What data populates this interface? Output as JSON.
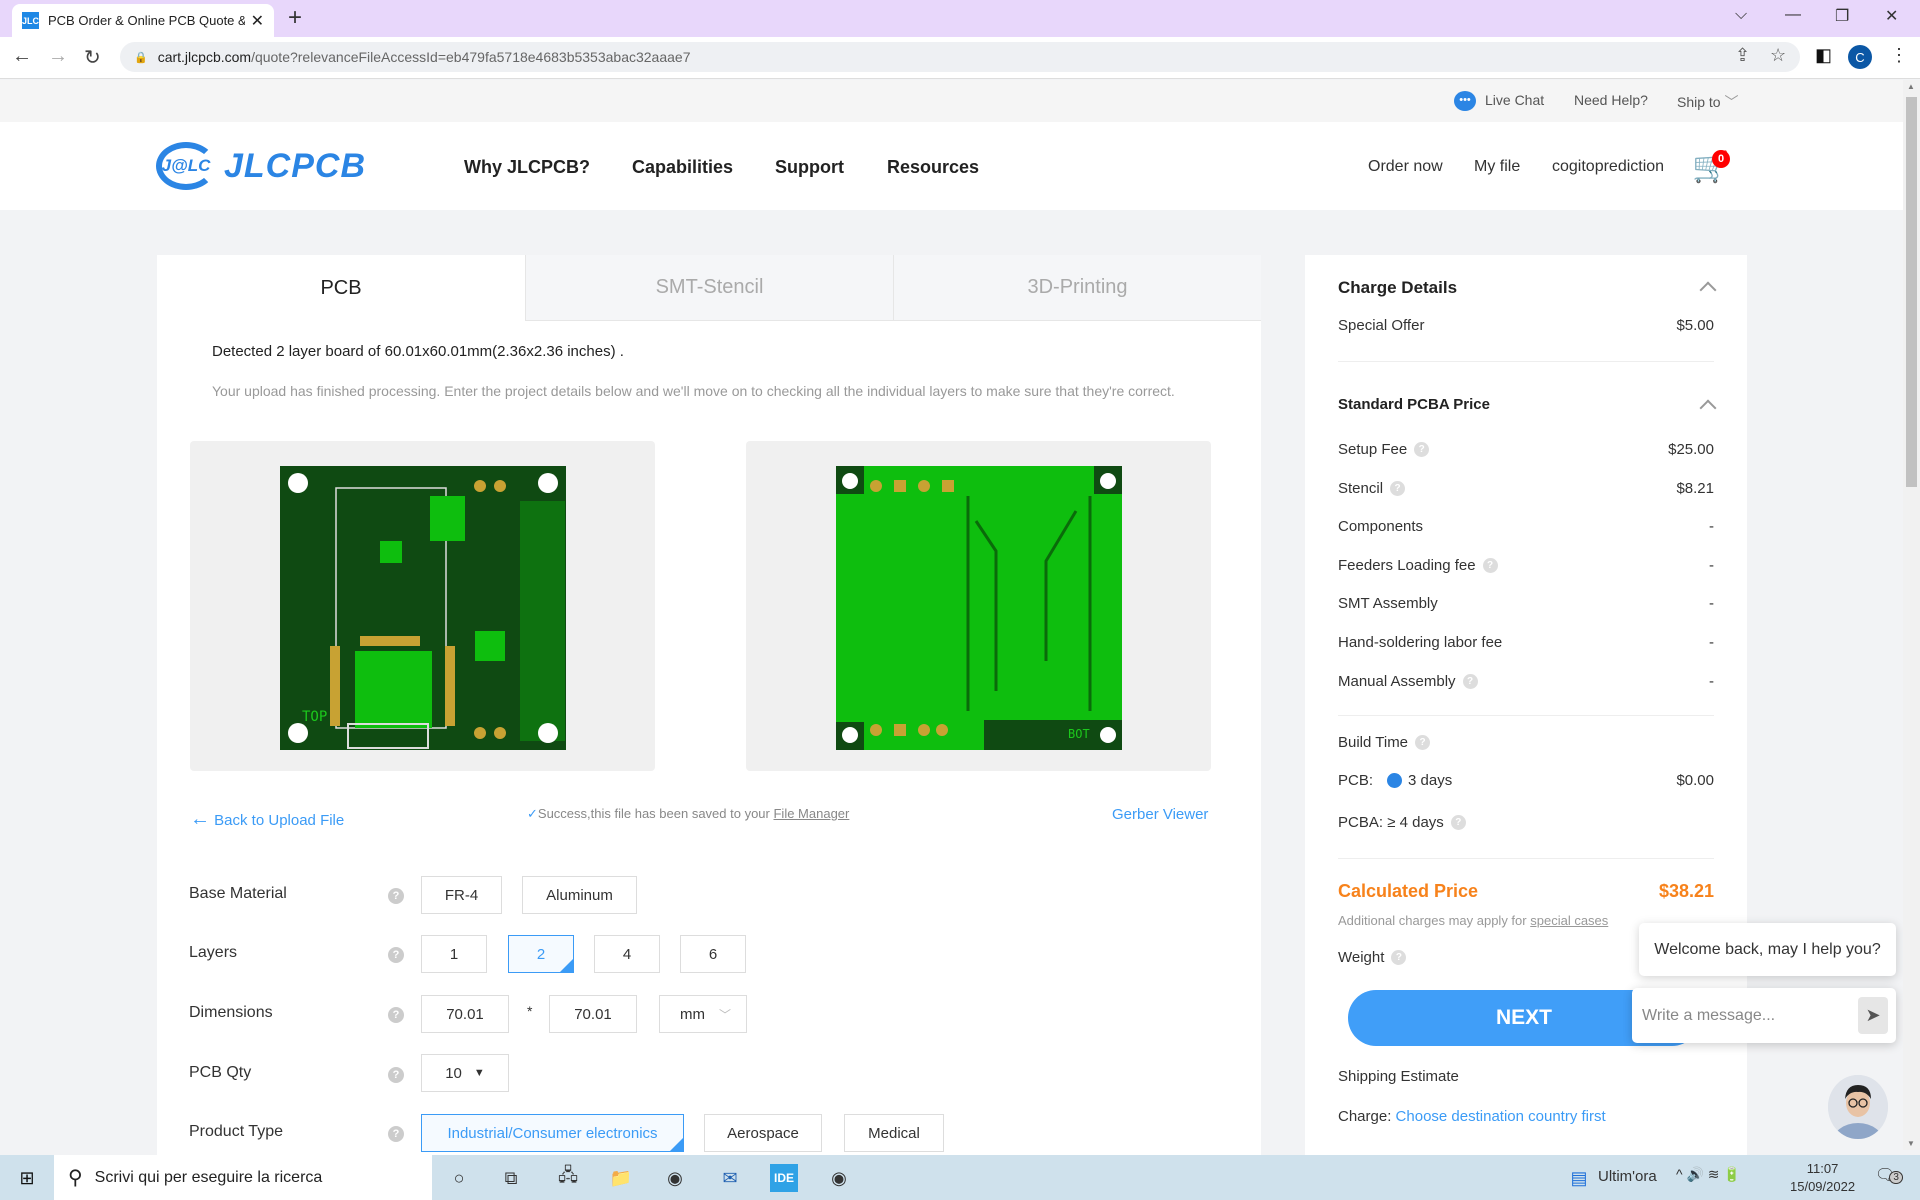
{
  "browser": {
    "tab_title": "PCB Order & Online PCB Quote & ...",
    "favicon_text": "JLC",
    "url_host": "cart.jlcpcb.com",
    "url_path": "/quote?relevanceFileAccessId=eb479fa5718e4683b5353abac32aaae7",
    "profile_initial": "C"
  },
  "topstrip": {
    "live_chat": "Live Chat",
    "need_help": "Need Help?",
    "ship_to": "Ship to"
  },
  "header": {
    "logo_mark": "J@LC",
    "logo_word": "JLCPCB",
    "nav": [
      "Why JLCPCB?",
      "Capabilities",
      "Support",
      "Resources"
    ],
    "order_now": "Order now",
    "my_file": "My file",
    "username": "cogitoprediction",
    "cart_count": "0"
  },
  "tabs": [
    {
      "label": "PCB",
      "active": true
    },
    {
      "label": "SMT-Stencil",
      "active": false
    },
    {
      "label": "3D-Printing",
      "active": false
    }
  ],
  "detect": {
    "detected_text": "Detected 2 layer board of 60.01x60.01mm(2.36x2.36 inches) .",
    "processing_text": "Your upload has finished processing. Enter the project details below and we'll move on to checking all the individual layers to make sure that they're correct.",
    "top_label": "TOP",
    "bottom_label": "BOT"
  },
  "links": {
    "back": "Back to Upload File",
    "success_prefix": "Success,this file has been saved to your ",
    "file_manager": "File Manager",
    "gerber_viewer": "Gerber Viewer"
  },
  "options": {
    "base_material": {
      "label": "Base Material",
      "choices": [
        "FR-4",
        "Aluminum"
      ],
      "selected": "FR-4"
    },
    "layers": {
      "label": "Layers",
      "choices": [
        "1",
        "2",
        "4",
        "6"
      ],
      "selected": "2"
    },
    "dimensions": {
      "label": "Dimensions",
      "width": "70.01",
      "sep": "*",
      "height": "70.01",
      "unit": "mm"
    },
    "pcb_qty": {
      "label": "PCB Qty",
      "value": "10"
    },
    "product_type": {
      "label": "Product Type",
      "choices": [
        "Industrial/Consumer electronics",
        "Aerospace",
        "Medical"
      ],
      "selected": "Industrial/Consumer electronics"
    }
  },
  "charges": {
    "title": "Charge Details",
    "special_offer_label": "Special Offer",
    "special_offer_value": "$5.00",
    "pcba_title": "Standard PCBA Price",
    "rows": [
      {
        "label": "Setup Fee",
        "value": "$25.00",
        "help": true
      },
      {
        "label": "Stencil",
        "value": "$8.21",
        "help": true
      },
      {
        "label": "Components",
        "value": "-",
        "help": false
      },
      {
        "label": "Feeders Loading fee",
        "value": "-",
        "help": true
      },
      {
        "label": "SMT Assembly",
        "value": "-",
        "help": false
      },
      {
        "label": "Hand-soldering labor fee",
        "value": "-",
        "help": false
      },
      {
        "label": "Manual Assembly",
        "value": "-",
        "help": true
      }
    ],
    "build_time_label": "Build Time",
    "pcb_time_label": "PCB:",
    "pcb_time_value": "3 days",
    "pcb_time_price": "$0.00",
    "pcba_time_label": "PCBA:",
    "pcba_time_value": "≥ 4 days",
    "calculated_label": "Calculated Price",
    "calculated_value": "$38.21",
    "additional_prefix": "Additional charges may apply for ",
    "special_cases": "special cases",
    "weight_label": "Weight",
    "next_label": "NEXT",
    "shipping_label": "Shipping Estimate",
    "charge_label": "Charge:",
    "charge_link": "Choose destination country first"
  },
  "chat": {
    "welcome": "Welcome back, may I help you?",
    "placeholder": "Write a message..."
  },
  "colors": {
    "brand": "#2b85e4",
    "accent": "#409ef8",
    "price": "#f7821b"
  },
  "taskbar": {
    "search_placeholder": "Scrivi qui per eseguire la ricerca",
    "news": "Ultim'ora",
    "time": "11:07",
    "date": "15/09/2022",
    "notifications": "3"
  }
}
